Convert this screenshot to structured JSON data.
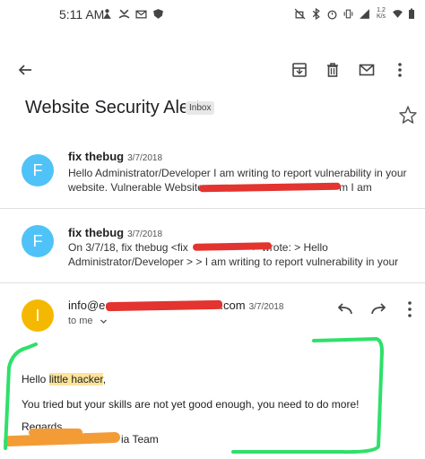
{
  "status_bar": {
    "time": "5:11 AM",
    "net_speed_top": "1.2",
    "net_speed_bottom": "K/s",
    "signal_label": "4G"
  },
  "toolbar": {
    "back_icon": "arrow-back-icon",
    "archive_icon": "archive-icon",
    "delete_icon": "trash-icon",
    "mark_unread_icon": "mail-icon",
    "more_icon": "more-vert-icon"
  },
  "thread": {
    "subject": "Website Security Alert",
    "label": "Inbox"
  },
  "messages": [
    {
      "avatar_letter": "F",
      "avatar_color": "#4fc3f7",
      "sender": "fix thebug",
      "date": "3/7/2018",
      "snippet_line1": "Hello Administrator/Developer I am writing to report vulnerability in your",
      "snippet_line2_start": "website. Vulnerable Website:",
      "snippet_line2_end": "m I am"
    },
    {
      "avatar_letter": "F",
      "avatar_color": "#4fc3f7",
      "sender": "fix thebug",
      "date": "3/7/2018",
      "snippet_line1_start": "On 3/7/18, fix thebug <fix",
      "snippet_line1_end": "> wrote: > Hello",
      "snippet_line2": "Administrator/Developer > > I am writing to report vulnerability in your"
    }
  ],
  "expanded": {
    "avatar_letter": "I",
    "avatar_color": "#f5b800",
    "from_start": "info@e",
    "from_end": ".com",
    "date": "3/7/2018",
    "to": "to me",
    "greeting_start": "Hello ",
    "greeting_highlight": "little hacker",
    "greeting_end": ",",
    "line2": "You tried but your skills are not yet good enough, you need to do more!",
    "regards": "Regards,",
    "signature_end": "ia Team"
  }
}
